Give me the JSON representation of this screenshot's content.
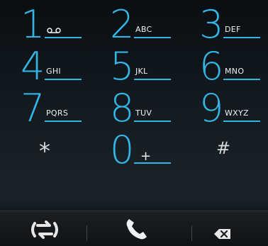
{
  "keypad": {
    "keys": [
      {
        "digit": "1",
        "letters": ""
      },
      {
        "digit": "2",
        "letters": "ABC"
      },
      {
        "digit": "3",
        "letters": "DEF"
      },
      {
        "digit": "4",
        "letters": "GHI"
      },
      {
        "digit": "5",
        "letters": "JKL"
      },
      {
        "digit": "6",
        "letters": "MNO"
      },
      {
        "digit": "7",
        "letters": "PQRS"
      },
      {
        "digit": "8",
        "letters": "TUV"
      },
      {
        "digit": "9",
        "letters": "WXYZ"
      }
    ],
    "star": "*",
    "zero": {
      "digit": "0",
      "letters": "+"
    },
    "hash": "#"
  },
  "icons": {
    "voicemail": "voicemail-icon",
    "swap": "swap-icon",
    "call": "phone-call-icon",
    "backspace": "backspace-icon"
  },
  "colors": {
    "accent": "#33b5e5",
    "text": "#f0f0f0",
    "icon": "#e6e6e6"
  }
}
